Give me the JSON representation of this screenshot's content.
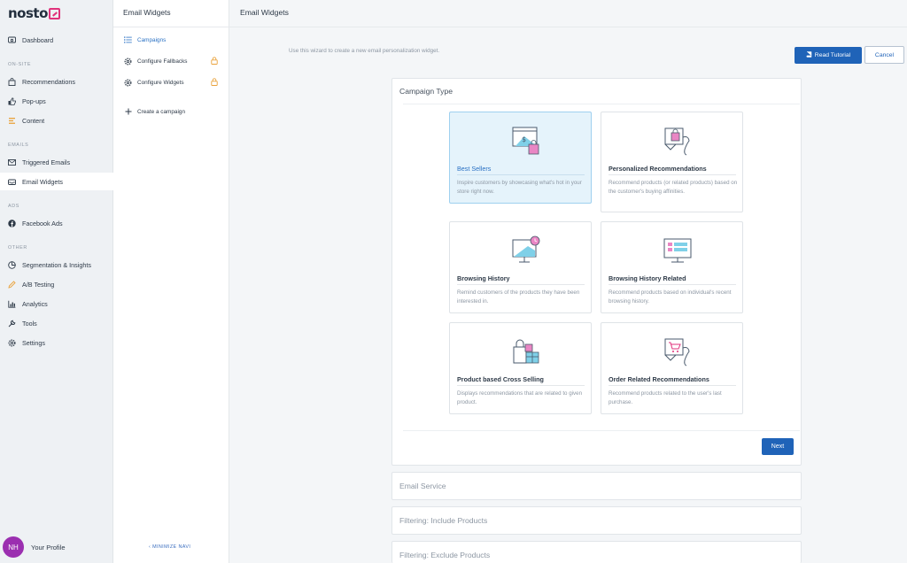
{
  "logo": {
    "text": "nosto"
  },
  "nav": {
    "dashboard": "Dashboard",
    "section_onsite": "ON-SITE",
    "recommendations": "Recommendations",
    "popups": "Pop-ups",
    "content": "Content",
    "section_emails": "EMAILS",
    "triggered_emails": "Triggered Emails",
    "email_widgets": "Email Widgets",
    "section_ads": "ADS",
    "facebook_ads": "Facebook Ads",
    "section_other": "OTHER",
    "segmentation": "Segmentation & Insights",
    "ab_testing": "A/B Testing",
    "analytics": "Analytics",
    "tools": "Tools",
    "settings": "Settings"
  },
  "profile": {
    "initials": "NH",
    "name": "Your Profile"
  },
  "subnav": {
    "title": "Email Widgets",
    "campaigns": "Campaigns",
    "configure_fallbacks": "Configure Fallbacks",
    "configure_widgets": "Configure Widgets",
    "create_campaign": "Create a campaign",
    "minimize": "MINIMIZE NAVI"
  },
  "main": {
    "title": "Email Widgets",
    "intro": "Use this wizard to create a new email personalization widget.",
    "read_tutorial": "Read Tutorial",
    "cancel": "Cancel",
    "campaign_type_title": "Campaign Type",
    "next": "Next",
    "email_service": "Email Service",
    "filter_include": "Filtering: Include Products",
    "filter_exclude": "Filtering: Exclude Products"
  },
  "cards": [
    {
      "title": "Best Sellers",
      "desc": "Inspire customers by showcasing what's hot in your store right now."
    },
    {
      "title": "Personalized Recommendations",
      "desc": "Recommend products (or related products) based on the customer's buying affinities."
    },
    {
      "title": "Browsing History",
      "desc": "Remind customers of the products they have been interested in."
    },
    {
      "title": "Browsing History Related",
      "desc": "Recommend products based on individual's recent browsing history."
    },
    {
      "title": "Product based Cross Selling",
      "desc": "Displays recommendations that are related to given product."
    },
    {
      "title": "Order Related Recommendations",
      "desc": "Recommend products related to the user's last purchase."
    }
  ],
  "colors": {
    "primary": "#1f63b8",
    "selected_bg": "#e5f3fb",
    "accent_pink": "#e0327b",
    "avatar": "#9b2fb0"
  }
}
